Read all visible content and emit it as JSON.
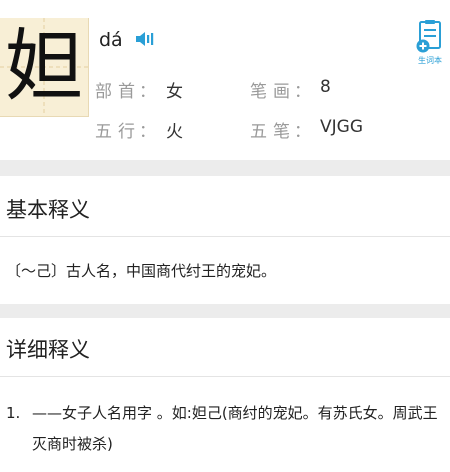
{
  "entry": {
    "character": "妲",
    "pinyin": "dá",
    "speaker_icon": "speaker-icon",
    "radical_label": "部首",
    "radical": "女",
    "strokes_label": "笔画",
    "strokes": "8",
    "element_label": "五行",
    "element": "火",
    "wubi_label": "五笔",
    "wubi": "VJGG",
    "label_separator": "：",
    "vocab_button_label": "生词本",
    "vocab_icon": "add-to-vocabulary-icon"
  },
  "basic": {
    "title": "基本释义",
    "text": "〔～己〕古人名，中国商代纣王的宠妃。"
  },
  "detail": {
    "title": "详细释义",
    "items": [
      {
        "number": "1.",
        "text": "——女子人名用字 。如:妲己(商纣的宠妃。有苏氏女。周武王灭商时被杀)"
      }
    ]
  },
  "colors": {
    "accent": "#2a9fd6",
    "tile_background": "#f8efd6",
    "page_background": "#ececec"
  }
}
